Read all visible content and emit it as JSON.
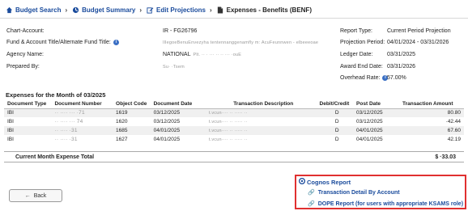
{
  "breadcrumbs": [
    {
      "label": "Budget Search"
    },
    {
      "label": "Budget Summary"
    },
    {
      "label": "Edit Projections"
    },
    {
      "label": "Expenses - Benefits (BENF)"
    }
  ],
  "info_left": {
    "chart_account": {
      "label": "Chart-Account:",
      "value": "IR - FG26796"
    },
    "fund_title": {
      "label": "Fund & Account Title/Alternate Fund Title:",
      "value": "IllegoeBenuEnvezyha tentennanggenamfly m: AcuFeunnwen - elbeeeoae"
    },
    "agency": {
      "label": "Agency Name:",
      "value": "NATIONAL",
      "value_extra": "Plt. ·· · ··· ·· ·· ··· ·ouE"
    },
    "prepared_by": {
      "label": "Prepared By:",
      "value": "Su· ·Tsem"
    }
  },
  "info_right": {
    "report_type": {
      "label": "Report Type:",
      "value": "Current Period Projection"
    },
    "projection_period": {
      "label": "Projection Period:",
      "value": "04/01/2024 - 03/31/2026"
    },
    "ledger_date": {
      "label": "Ledger Date:",
      "value": "03/31/2025"
    },
    "award_end_date": {
      "label": "Award End Date:",
      "value": "03/31/2026"
    },
    "overhead_rate": {
      "label": "Overhead Rate:",
      "value": "57.00%"
    }
  },
  "expenses": {
    "title": "Expenses for the Month of 03/2025",
    "headers": [
      "Document Type",
      "Document Number",
      "Object Code",
      "Document Date",
      "Transaction Description",
      "Debit/Credit",
      "Post Date",
      "Transaction Amount"
    ],
    "rows": [
      {
        "doc_type": "IBI",
        "doc_number": "·· ···· ··· ·71",
        "object_code": "1619",
        "doc_date": "03/12/2025",
        "description": "t.vcun···· ·· ····· ··",
        "dc": "D",
        "post_date": "03/12/2025",
        "amount": "80.80"
      },
      {
        "doc_type": "IBI",
        "doc_number": "·· ···· ··· 74",
        "object_code": "1620",
        "doc_date": "03/12/2025",
        "description": "t.vcun···· ·· ····· ··",
        "dc": "D",
        "post_date": "03/12/2025",
        "amount": "·42.44"
      },
      {
        "doc_type": "IBI",
        "doc_number": "·· ···· ·31",
        "object_code": "1685",
        "doc_date": "04/01/2025",
        "description": "t.vcun···· ·· ····· ··",
        "dc": "D",
        "post_date": "04/01/2025",
        "amount": "67.60"
      },
      {
        "doc_type": "IBI",
        "doc_number": "·· ···· ·31",
        "object_code": "1627",
        "doc_date": "04/01/2025",
        "description": "t.vcun···· ·· ····· ··",
        "dc": "D",
        "post_date": "04/01/2025",
        "amount": "42.19"
      }
    ],
    "total_label": "Current Month Expense Total",
    "total_value": "$ ·33.03"
  },
  "back_button": {
    "label": "Back"
  },
  "cognos": {
    "title": "Cognos Report",
    "links": [
      {
        "label": "Transaction Detail By Account"
      },
      {
        "label": "DOPE Report (for users with appropriate KSAMS role)"
      }
    ]
  },
  "colors": {
    "link": "#1a4b9c",
    "highlight_border": "#e03030",
    "row_alt": "#f0f0f0"
  }
}
